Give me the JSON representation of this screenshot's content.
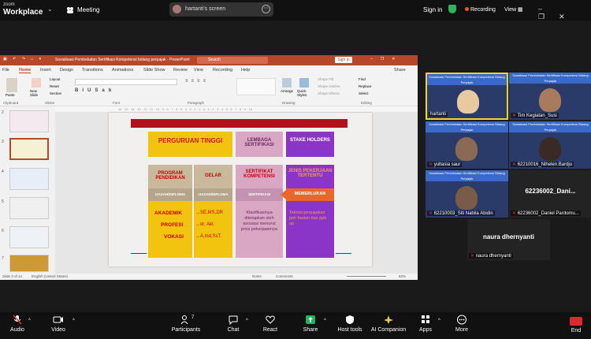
{
  "zoom": {
    "brand_top": "zoom",
    "brand_bottom": "Workplace",
    "meeting_label": "Meeting",
    "screen_label": "hartanti's screen",
    "signin": "Sign in",
    "recording": "Recording",
    "view": "View"
  },
  "ppt": {
    "title": "Sosialisasi Pembekalan Sertifikasi Kompetensi bidang perpajak  -  PowerPoint",
    "search": "Search",
    "signin": "Sign in",
    "menu": [
      "File",
      "Home",
      "Insert",
      "Design",
      "Transitions",
      "Animations",
      "Slide Show",
      "Review",
      "View",
      "Recording",
      "Help"
    ],
    "share": "Share",
    "ribbon_groups": [
      "Clipboard",
      "Slides",
      "Font",
      "Paragraph",
      "Drawing",
      "Editing"
    ],
    "ribbon_labels": {
      "paste": "Paste",
      "new_slide": "New Slide",
      "layout": "Layout",
      "reset": "Reset",
      "section": "Section",
      "arrange": "Arrange",
      "quick_styles": "Quick Styles",
      "shape_fill": "Shape Fill",
      "shape_outline": "Shape Outline",
      "shape_effects": "Shape Effects",
      "find": "Find",
      "replace": "Replace",
      "select": "Select"
    },
    "thumbs": [
      "2",
      "3",
      "4",
      "5",
      "6",
      "7"
    ],
    "status_left": "Slide 3 of 14",
    "status_lang": "English (United States)",
    "notes": "Notes",
    "comments": "Comments",
    "zoom_pct": "83%"
  },
  "slide": {
    "col1_head": "PERGURUAN TINGGI",
    "col2_head": "LEMBAGA SERTIFIKASI",
    "col3_head": "STAKE HOLDERS",
    "row2_c1": "PROGRAM PENDIDIKAN",
    "row2_c2": "GELAR",
    "row2_c3": "SERTIFIKAT KOMPETENSI",
    "row2_c4": "JENIS PEKERJAAN TERTENTU",
    "mid_c1": "IJAZAH/DIPLOMA",
    "mid_c2": "IJAZAH/DIPLOMA",
    "mid_c3": "SERTIFIKASI",
    "memerlukan": "MEMERLUKAN",
    "prog_list": [
      "AKADEMIK",
      "PROFESI",
      "VOKASI"
    ],
    "gelar_list": [
      "SE,MS,DR",
      "dr, Akt.",
      "A.md,SsT."
    ],
    "klasifikasi": "Klasifikasinya ditetapkan oleh asosiasi menurut jenis pekerjaannya",
    "teknisi": "Teknisi perpajakan pph badan dan pph op"
  },
  "tiles": [
    {
      "name": "hartanti",
      "banner": "Sosialisasi Pembekalan Sertifikasi Kompetensi Bidang Perpajak"
    },
    {
      "name": "Tim Kegiatan_Susi",
      "banner": "Sosialisasi Pembekalan Sertifikasi Kompetensi Bidang Perpajak"
    },
    {
      "name": "yultasia saur",
      "banner": "Sosialisasi Pembekalan Sertifikasi Kompetensi Bidang Perpajak"
    },
    {
      "name": "62210016_Nihelen Bardjo",
      "banner": "Sosialisasi Pembekalan Sertifikasi Kompetensi Bidang Perpajak"
    },
    {
      "name": "62210003_Siti Nabila Abidin",
      "banner": "Sosialisasi Pembekalan Sertifikasi Kompetensi Bidang Perpajak"
    },
    {
      "name": "62236002_Daniel Pardomu...",
      "big": "62236002_Dani..."
    },
    {
      "name": "naura dhernyanti",
      "big": "naura dhernyanti"
    }
  ],
  "toolbar": {
    "audio": "Audio",
    "video": "Video",
    "participants": "Participants",
    "participants_count": "7",
    "chat": "Chat",
    "react": "React",
    "share": "Share",
    "host_tools": "Host tools",
    "ai_companion": "AI Companion",
    "apps": "Apps",
    "more": "More",
    "end": "End"
  }
}
